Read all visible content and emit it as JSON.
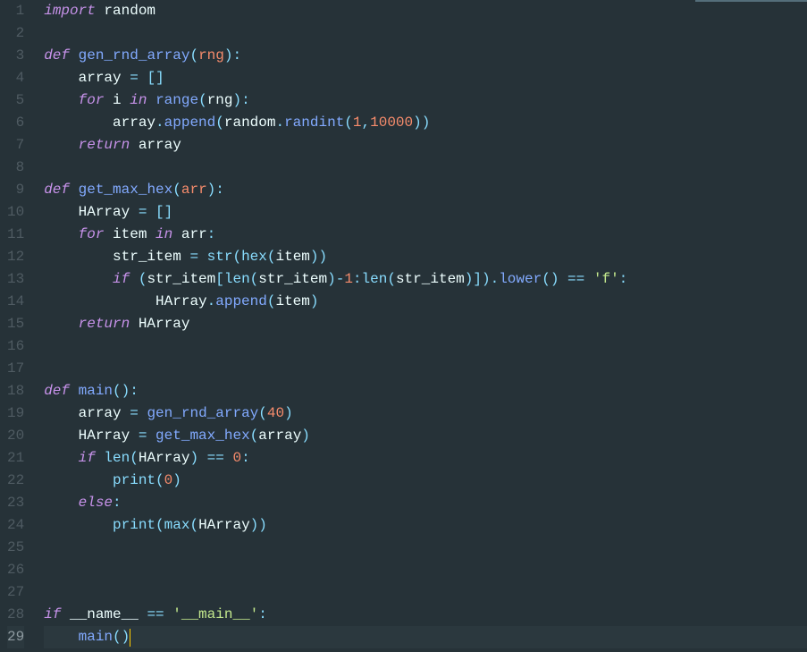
{
  "code": {
    "lines": [
      {
        "n": 1,
        "tokens": [
          {
            "t": "import",
            "c": "kw"
          },
          {
            "t": " ",
            "c": ""
          },
          {
            "t": "random",
            "c": "id"
          }
        ]
      },
      {
        "n": 2,
        "tokens": []
      },
      {
        "n": 3,
        "tokens": [
          {
            "t": "def",
            "c": "kw"
          },
          {
            "t": " ",
            "c": ""
          },
          {
            "t": "gen_rnd_array",
            "c": "fn"
          },
          {
            "t": "(",
            "c": "punc"
          },
          {
            "t": "rng",
            "c": "param"
          },
          {
            "t": ")",
            "c": "punc"
          },
          {
            "t": ":",
            "c": "punc"
          }
        ]
      },
      {
        "n": 4,
        "tokens": [
          {
            "t": "    ",
            "c": ""
          },
          {
            "t": "array",
            "c": "id"
          },
          {
            "t": " ",
            "c": ""
          },
          {
            "t": "=",
            "c": "op"
          },
          {
            "t": " ",
            "c": ""
          },
          {
            "t": "[",
            "c": "punc"
          },
          {
            "t": "]",
            "c": "punc"
          }
        ]
      },
      {
        "n": 5,
        "tokens": [
          {
            "t": "    ",
            "c": ""
          },
          {
            "t": "for",
            "c": "kw"
          },
          {
            "t": " ",
            "c": ""
          },
          {
            "t": "i",
            "c": "id"
          },
          {
            "t": " ",
            "c": ""
          },
          {
            "t": "in",
            "c": "kw"
          },
          {
            "t": " ",
            "c": ""
          },
          {
            "t": "range",
            "c": "call"
          },
          {
            "t": "(",
            "c": "punc"
          },
          {
            "t": "rng",
            "c": "id"
          },
          {
            "t": ")",
            "c": "punc"
          },
          {
            "t": ":",
            "c": "punc"
          }
        ]
      },
      {
        "n": 6,
        "tokens": [
          {
            "t": "        ",
            "c": ""
          },
          {
            "t": "array",
            "c": "id"
          },
          {
            "t": ".",
            "c": "punc"
          },
          {
            "t": "append",
            "c": "call"
          },
          {
            "t": "(",
            "c": "punc"
          },
          {
            "t": "random",
            "c": "id"
          },
          {
            "t": ".",
            "c": "punc"
          },
          {
            "t": "randint",
            "c": "call"
          },
          {
            "t": "(",
            "c": "punc"
          },
          {
            "t": "1",
            "c": "num"
          },
          {
            "t": ",",
            "c": "punc"
          },
          {
            "t": "10000",
            "c": "num"
          },
          {
            "t": ")",
            "c": "punc"
          },
          {
            "t": ")",
            "c": "punc"
          }
        ]
      },
      {
        "n": 7,
        "tokens": [
          {
            "t": "    ",
            "c": ""
          },
          {
            "t": "return",
            "c": "kw"
          },
          {
            "t": " ",
            "c": ""
          },
          {
            "t": "array",
            "c": "id"
          }
        ]
      },
      {
        "n": 8,
        "tokens": []
      },
      {
        "n": 9,
        "tokens": [
          {
            "t": "def",
            "c": "kw"
          },
          {
            "t": " ",
            "c": ""
          },
          {
            "t": "get_max_hex",
            "c": "fn"
          },
          {
            "t": "(",
            "c": "punc"
          },
          {
            "t": "arr",
            "c": "param"
          },
          {
            "t": ")",
            "c": "punc"
          },
          {
            "t": ":",
            "c": "punc"
          }
        ]
      },
      {
        "n": 10,
        "tokens": [
          {
            "t": "    ",
            "c": ""
          },
          {
            "t": "HArray",
            "c": "id"
          },
          {
            "t": " ",
            "c": ""
          },
          {
            "t": "=",
            "c": "op"
          },
          {
            "t": " ",
            "c": ""
          },
          {
            "t": "[",
            "c": "punc"
          },
          {
            "t": "]",
            "c": "punc"
          }
        ]
      },
      {
        "n": 11,
        "tokens": [
          {
            "t": "    ",
            "c": ""
          },
          {
            "t": "for",
            "c": "kw"
          },
          {
            "t": " ",
            "c": ""
          },
          {
            "t": "item",
            "c": "id"
          },
          {
            "t": " ",
            "c": ""
          },
          {
            "t": "in",
            "c": "kw"
          },
          {
            "t": " ",
            "c": ""
          },
          {
            "t": "arr",
            "c": "id"
          },
          {
            "t": ":",
            "c": "punc"
          }
        ]
      },
      {
        "n": 12,
        "tokens": [
          {
            "t": "        ",
            "c": ""
          },
          {
            "t": "str_item",
            "c": "id"
          },
          {
            "t": " ",
            "c": ""
          },
          {
            "t": "=",
            "c": "op"
          },
          {
            "t": " ",
            "c": ""
          },
          {
            "t": "str",
            "c": "builtin"
          },
          {
            "t": "(",
            "c": "punc"
          },
          {
            "t": "hex",
            "c": "builtin"
          },
          {
            "t": "(",
            "c": "punc"
          },
          {
            "t": "item",
            "c": "id"
          },
          {
            "t": ")",
            "c": "punc"
          },
          {
            "t": ")",
            "c": "punc"
          }
        ]
      },
      {
        "n": 13,
        "tokens": [
          {
            "t": "        ",
            "c": ""
          },
          {
            "t": "if",
            "c": "kw"
          },
          {
            "t": " ",
            "c": ""
          },
          {
            "t": "(",
            "c": "punc"
          },
          {
            "t": "str_item",
            "c": "id"
          },
          {
            "t": "[",
            "c": "punc"
          },
          {
            "t": "len",
            "c": "builtin"
          },
          {
            "t": "(",
            "c": "punc"
          },
          {
            "t": "str_item",
            "c": "id"
          },
          {
            "t": ")",
            "c": "punc"
          },
          {
            "t": "-",
            "c": "op"
          },
          {
            "t": "1",
            "c": "num"
          },
          {
            "t": ":",
            "c": "punc"
          },
          {
            "t": "len",
            "c": "builtin"
          },
          {
            "t": "(",
            "c": "punc"
          },
          {
            "t": "str_item",
            "c": "id"
          },
          {
            "t": ")",
            "c": "punc"
          },
          {
            "t": "]",
            "c": "punc"
          },
          {
            "t": ")",
            "c": "punc"
          },
          {
            "t": ".",
            "c": "punc"
          },
          {
            "t": "lower",
            "c": "call"
          },
          {
            "t": "(",
            "c": "punc"
          },
          {
            "t": ")",
            "c": "punc"
          },
          {
            "t": " ",
            "c": ""
          },
          {
            "t": "==",
            "c": "op"
          },
          {
            "t": " ",
            "c": ""
          },
          {
            "t": "'f'",
            "c": "str"
          },
          {
            "t": ":",
            "c": "punc"
          }
        ]
      },
      {
        "n": 14,
        "tokens": [
          {
            "t": "             ",
            "c": ""
          },
          {
            "t": "HArray",
            "c": "id"
          },
          {
            "t": ".",
            "c": "punc"
          },
          {
            "t": "append",
            "c": "call"
          },
          {
            "t": "(",
            "c": "punc"
          },
          {
            "t": "item",
            "c": "id"
          },
          {
            "t": ")",
            "c": "punc"
          }
        ]
      },
      {
        "n": 15,
        "tokens": [
          {
            "t": "    ",
            "c": ""
          },
          {
            "t": "return",
            "c": "kw"
          },
          {
            "t": " ",
            "c": ""
          },
          {
            "t": "HArray",
            "c": "id"
          }
        ]
      },
      {
        "n": 16,
        "tokens": []
      },
      {
        "n": 17,
        "tokens": []
      },
      {
        "n": 18,
        "tokens": [
          {
            "t": "def",
            "c": "kw"
          },
          {
            "t": " ",
            "c": ""
          },
          {
            "t": "main",
            "c": "fn"
          },
          {
            "t": "(",
            "c": "punc"
          },
          {
            "t": ")",
            "c": "punc"
          },
          {
            "t": ":",
            "c": "punc"
          }
        ]
      },
      {
        "n": 19,
        "tokens": [
          {
            "t": "    ",
            "c": ""
          },
          {
            "t": "array",
            "c": "id"
          },
          {
            "t": " ",
            "c": ""
          },
          {
            "t": "=",
            "c": "op"
          },
          {
            "t": " ",
            "c": ""
          },
          {
            "t": "gen_rnd_array",
            "c": "call"
          },
          {
            "t": "(",
            "c": "punc"
          },
          {
            "t": "40",
            "c": "num"
          },
          {
            "t": ")",
            "c": "punc"
          }
        ]
      },
      {
        "n": 20,
        "tokens": [
          {
            "t": "    ",
            "c": ""
          },
          {
            "t": "HArray",
            "c": "id"
          },
          {
            "t": " ",
            "c": ""
          },
          {
            "t": "=",
            "c": "op"
          },
          {
            "t": " ",
            "c": ""
          },
          {
            "t": "get_max_hex",
            "c": "call"
          },
          {
            "t": "(",
            "c": "punc"
          },
          {
            "t": "array",
            "c": "id"
          },
          {
            "t": ")",
            "c": "punc"
          }
        ]
      },
      {
        "n": 21,
        "tokens": [
          {
            "t": "    ",
            "c": ""
          },
          {
            "t": "if",
            "c": "kw"
          },
          {
            "t": " ",
            "c": ""
          },
          {
            "t": "len",
            "c": "builtin"
          },
          {
            "t": "(",
            "c": "punc"
          },
          {
            "t": "HArray",
            "c": "id"
          },
          {
            "t": ")",
            "c": "punc"
          },
          {
            "t": " ",
            "c": ""
          },
          {
            "t": "==",
            "c": "op"
          },
          {
            "t": " ",
            "c": ""
          },
          {
            "t": "0",
            "c": "num"
          },
          {
            "t": ":",
            "c": "punc"
          }
        ]
      },
      {
        "n": 22,
        "tokens": [
          {
            "t": "        ",
            "c": ""
          },
          {
            "t": "print",
            "c": "builtin"
          },
          {
            "t": "(",
            "c": "punc"
          },
          {
            "t": "0",
            "c": "num"
          },
          {
            "t": ")",
            "c": "punc"
          }
        ]
      },
      {
        "n": 23,
        "tokens": [
          {
            "t": "    ",
            "c": ""
          },
          {
            "t": "else",
            "c": "kw"
          },
          {
            "t": ":",
            "c": "punc"
          }
        ]
      },
      {
        "n": 24,
        "tokens": [
          {
            "t": "        ",
            "c": ""
          },
          {
            "t": "print",
            "c": "builtin"
          },
          {
            "t": "(",
            "c": "punc"
          },
          {
            "t": "max",
            "c": "builtin"
          },
          {
            "t": "(",
            "c": "punc"
          },
          {
            "t": "HArray",
            "c": "id"
          },
          {
            "t": ")",
            "c": "punc"
          },
          {
            "t": ")",
            "c": "punc"
          }
        ]
      },
      {
        "n": 25,
        "tokens": []
      },
      {
        "n": 26,
        "tokens": []
      },
      {
        "n": 27,
        "tokens": []
      },
      {
        "n": 28,
        "tokens": [
          {
            "t": "if",
            "c": "kw"
          },
          {
            "t": " ",
            "c": ""
          },
          {
            "t": "__name__",
            "c": "id"
          },
          {
            "t": " ",
            "c": ""
          },
          {
            "t": "==",
            "c": "op"
          },
          {
            "t": " ",
            "c": ""
          },
          {
            "t": "'__main__'",
            "c": "str"
          },
          {
            "t": ":",
            "c": "punc"
          }
        ]
      },
      {
        "n": 29,
        "tokens": [
          {
            "t": "    ",
            "c": ""
          },
          {
            "t": "main",
            "c": "call"
          },
          {
            "t": "(",
            "c": "punc"
          },
          {
            "t": ")",
            "c": "punc"
          }
        ],
        "current": true,
        "cursor": true
      }
    ]
  }
}
